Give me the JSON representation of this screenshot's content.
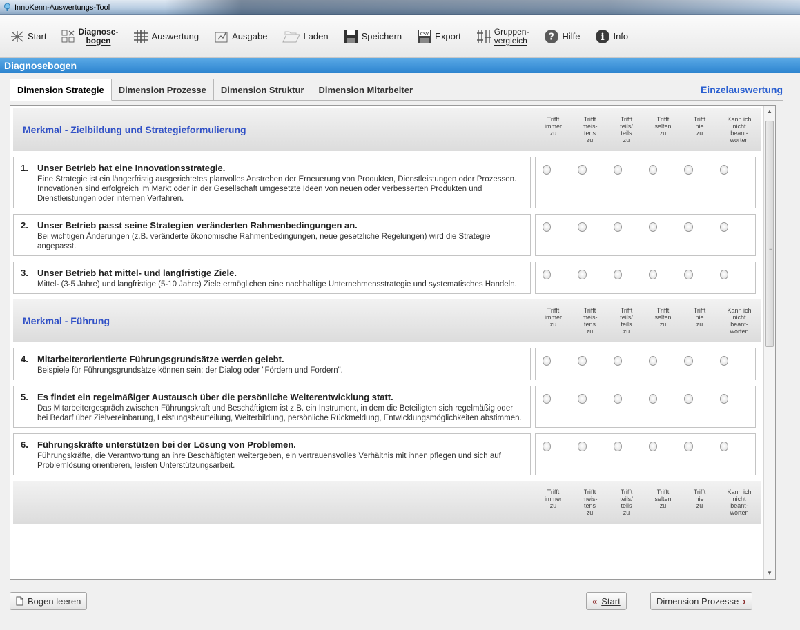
{
  "window": {
    "title": "InnoKenn-Auswertungs-Tool"
  },
  "toolbar": {
    "start": "Start",
    "diagnose_line1": "Diagnose-",
    "diagnose_line2": "bogen",
    "auswertung": "Auswertung",
    "ausgabe": "Ausgabe",
    "laden": "Laden",
    "speichern": "Speichern",
    "export": "Export",
    "gruppen_line1": "Gruppen-",
    "gruppen_line2": "vergleich",
    "hilfe": "Hilfe",
    "info": "Info"
  },
  "section": {
    "title": "Diagnosebogen"
  },
  "tabs": [
    {
      "label": "Dimension Strategie"
    },
    {
      "label": "Dimension Prozesse"
    },
    {
      "label": "Dimension Struktur"
    },
    {
      "label": "Dimension Mitarbeiter"
    }
  ],
  "einzelauswertung": "Einzelauswertung",
  "columns": [
    {
      "l1": "Trifft",
      "l2": "immer",
      "l3": "zu",
      "l4": ""
    },
    {
      "l1": "Trifft",
      "l2": "meis-",
      "l3": "tens",
      "l4": "zu"
    },
    {
      "l1": "Trifft",
      "l2": "teils/",
      "l3": "teils",
      "l4": "zu"
    },
    {
      "l1": "Trifft",
      "l2": "selten",
      "l3": "zu",
      "l4": ""
    },
    {
      "l1": "Trifft",
      "l2": "nie",
      "l3": "zu",
      "l4": ""
    },
    {
      "l1": "Kann ich",
      "l2": "nicht",
      "l3": "beant-",
      "l4": "worten"
    }
  ],
  "merkmale": [
    {
      "title": "Merkmal - Zielbildung und Strategieformulierung",
      "questions": [
        {
          "num": "1.",
          "title": "Unser Betrieb hat eine Innovationsstrategie.",
          "desc": "Eine Strategie ist ein längerfristig ausgerichtetes planvolles Anstreben der Erneuerung von Produkten, Dienstleistungen oder Prozessen. Innovationen sind erfolgreich im Markt oder in der Gesellschaft umgesetzte Ideen von neuen oder verbesserten Produkten und Dienstleistungen oder internen Verfahren."
        },
        {
          "num": "2.",
          "title": "Unser Betrieb passt seine Strategien veränderten Rahmenbedingungen an.",
          "desc": "Bei wichtigen Änderungen (z.B. veränderte ökonomische Rahmenbedingungen, neue gesetzliche Regelungen) wird die Strategie angepasst."
        },
        {
          "num": "3.",
          "title": "Unser Betrieb hat mittel- und langfristige Ziele.",
          "desc": "Mittel- (3-5 Jahre) und langfristige (5-10 Jahre) Ziele ermöglichen eine nachhaltige Unternehmensstrategie und systematisches Handeln."
        }
      ]
    },
    {
      "title": "Merkmal - Führung",
      "questions": [
        {
          "num": "4.",
          "title": "Mitarbeiterorientierte Führungsgrundsätze werden gelebt.",
          "desc": "Beispiele für Führungsgrundsätze können sein: der Dialog oder \"Fördern und Fordern\"."
        },
        {
          "num": "5.",
          "title": "Es findet ein regelmäßiger Austausch über die persönliche Weiterentwicklung statt.",
          "desc": "Das Mitarbeitergespräch zwischen Führungskraft und Beschäftigtem ist z.B. ein Instrument, in dem die Beteiligten sich regelmäßig oder bei Bedarf über Zielvereinbarung, Leistungsbeurteilung, Weiterbildung, persönliche Rückmeldung, Entwicklungsmöglichkeiten abstimmen."
        },
        {
          "num": "6.",
          "title": "Führungskräfte unterstützen bei der Lösung von Problemen.",
          "desc": "Führungskräfte, die Verantwortung an ihre Beschäftigten weitergeben, ein vertrauensvolles Verhältnis mit ihnen pflegen und sich auf Problemlösung orientieren, leisten Unterstützungsarbeit."
        }
      ]
    }
  ],
  "footer": {
    "bogen_leeren": "Bogen leeren",
    "start_btn": "Start",
    "next_btn": "Dimension Prozesse"
  },
  "colors": {
    "accent": "#2d84cf",
    "merkmal_text": "#3151c6",
    "einzel_text": "#2a5fd0"
  }
}
